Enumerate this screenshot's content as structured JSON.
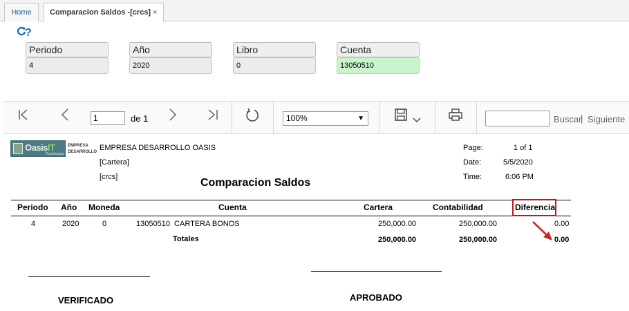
{
  "tabs": [
    {
      "label": "Home"
    },
    {
      "label": "Comparacion Saldos -[crcs]",
      "close": "×"
    }
  ],
  "toolbar_icons": {
    "refresh": "refresh-icon",
    "help": "help-icon"
  },
  "params": {
    "periodo": {
      "label": "Periodo",
      "value": "4"
    },
    "anio": {
      "label": "Año",
      "value": "2020"
    },
    "libro": {
      "label": "Libro",
      "value": "0"
    },
    "cuenta": {
      "label": "Cuenta",
      "value": "13050510"
    }
  },
  "viewer": {
    "page_value": "1",
    "page_of": "de 1",
    "zoom": "100%",
    "search_label": "Buscar",
    "pipe": "|",
    "next_label": "Siguiente"
  },
  "report": {
    "company": "EMPRESA DESARROLLO OASIS",
    "logo_text_main": "Oasis",
    "logo_text_it": "IT",
    "logo_sub": "Tecnologias",
    "logo_side_1": "EMPRESA",
    "logo_side_2": "DESARROLLO",
    "category": "[Cartera]",
    "code": "[crcs]",
    "title": "Comparacion Saldos",
    "page_label": "Page:",
    "page_value": "1 of 1",
    "date_label": "Date:",
    "date_value": "5/5/2020",
    "time_label": "Time:",
    "time_value": "6:06 PM",
    "columns": {
      "periodo": "Periodo",
      "anio": "Año",
      "moneda": "Moneda",
      "cuenta": "Cuenta",
      "cartera": "Cartera",
      "contabilidad": "Contabilidad",
      "diferencia": "Diferencia"
    },
    "row": {
      "periodo": "4",
      "anio": "2020",
      "moneda": "0",
      "cuenta": "13050510  CARTERA BONOS",
      "cartera": "250,000.00",
      "contabilidad": "250,000.00",
      "diferencia": "0.00"
    },
    "totals": {
      "label": "Totales",
      "cartera": "250,000.00",
      "contabilidad": "250,000.00",
      "diferencia": "0.00"
    },
    "sign_verificado": "VERIFICADO",
    "sign_aprobado": "APROBADO"
  },
  "colors": {
    "highlight": "#b71c1c",
    "arrow": "#c62828",
    "cuenta_field": "#c9f5cd",
    "link": "#1f5d95"
  }
}
